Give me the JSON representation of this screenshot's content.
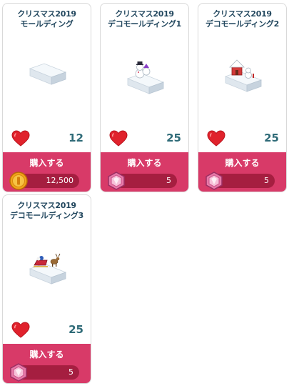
{
  "items": [
    {
      "title_line1": "クリスマス2019",
      "title_line2": "モールディング",
      "likes": "12",
      "buy_label": "購入する",
      "price": "12,500",
      "currency_icon": "coin-icon",
      "art_icon": "snow-molding-icon"
    },
    {
      "title_line1": "クリスマス2019",
      "title_line2": "デコモールディング1",
      "likes": "25",
      "buy_label": "購入する",
      "price": "5",
      "currency_icon": "gem-icon",
      "art_icon": "snowman-molding-icon"
    },
    {
      "title_line1": "クリスマス2019",
      "title_line2": "デコモールディング2",
      "likes": "25",
      "buy_label": "購入する",
      "price": "5",
      "currency_icon": "gem-icon",
      "art_icon": "house-molding-icon"
    },
    {
      "title_line1": "クリスマス2019",
      "title_line2": "デコモールディング3",
      "likes": "25",
      "buy_label": "購入する",
      "price": "5",
      "currency_icon": "gem-icon",
      "art_icon": "sleigh-molding-icon"
    }
  ],
  "colors": {
    "buy_bar": "#d83a68",
    "price_pill": "#a51e40",
    "title_text": "#23485f",
    "like_count": "#2f6b78",
    "heart": "#e0222c"
  }
}
